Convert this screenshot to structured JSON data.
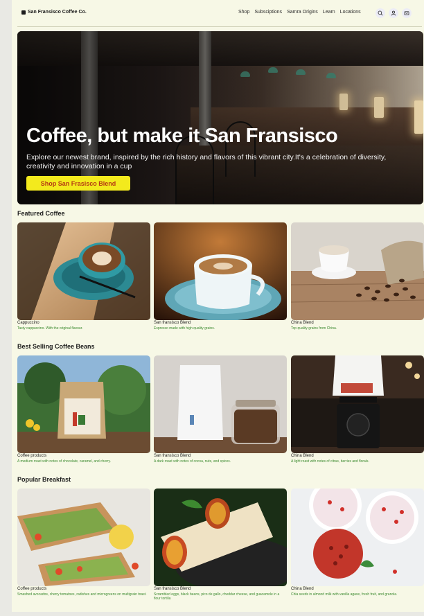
{
  "brand": {
    "name": "San Fransisco Coffee Co."
  },
  "nav": {
    "links": [
      "Shop",
      "Subsciptions",
      "Samra Origins",
      "Learn",
      "Locations"
    ],
    "icons": [
      "search-icon",
      "user-icon",
      "cart-icon"
    ]
  },
  "hero": {
    "title": "Coffee, but make it San Fransisco",
    "subtitle": "Explore our newest brand, inspired by the rich history and flavors of this vibrant city.It's a celebration of diversity, creativity and innovation in a cup",
    "cta": "Shop San Frasisco Blend"
  },
  "sections": [
    {
      "title": "Featured Coffee",
      "items": [
        {
          "title": "Cappuccino",
          "desc": "Tasty cappuccino. With the original flavour."
        },
        {
          "title": "San fransisco Blend",
          "desc": "Espresso made with high quality grains."
        },
        {
          "title": "China Blend",
          "desc": "Top quality grains from China."
        }
      ]
    },
    {
      "title": "Best Selling Coffee Beans",
      "items": [
        {
          "title": "Coffee products",
          "desc": "A medium roast with notes of chocolate, caramel, and cherry."
        },
        {
          "title": "San fransisco Blend",
          "desc": "A dark roast with notes of cocoa, nuts, and spices."
        },
        {
          "title": "China Blend",
          "desc": "A light roast with notes of citrus, berries and florals."
        }
      ]
    },
    {
      "title": "Popular Breakfast",
      "items": [
        {
          "title": "Coffee products",
          "desc": "Smashed avocados, cherry tomatoes, radishes and microgreens on multigrain toast."
        },
        {
          "title": "San fransisco Blend",
          "desc": "Scrambled eggs, black beans, pico de gallo, cheddar cheese, and guacamole in a flour tortilla"
        },
        {
          "title": "China Blend",
          "desc": "Chia seeds in almond milk with vanilla agave, fresh fruit, and granola."
        }
      ]
    }
  ],
  "colors": {
    "page_bg": "#f7f8e6",
    "cta_bg": "#f3ea1d",
    "cta_text": "#b43a14",
    "desc_text": "#3b8a2e"
  }
}
